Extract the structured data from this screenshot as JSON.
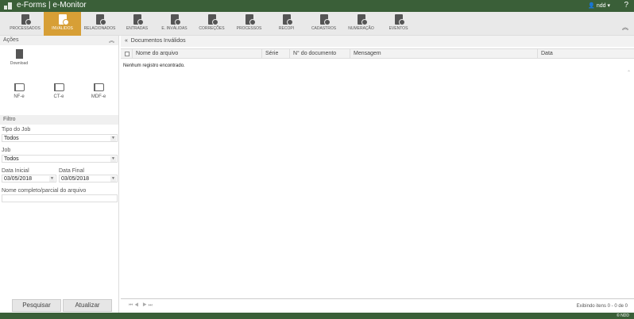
{
  "app": {
    "title": "e-Forms | e-Monitor",
    "user": "ndd",
    "help": "?",
    "copyright": "© NDD"
  },
  "toolbar": {
    "items": [
      {
        "label": "PROCESSADOS",
        "icon": "doc-check-icon"
      },
      {
        "label": "INVÁLIDOS",
        "icon": "doc-x-icon",
        "active": true
      },
      {
        "label": "RELACIONADOS",
        "icon": "doc-link-icon"
      },
      {
        "label": "ENTRADAS",
        "icon": "doc-in-icon"
      },
      {
        "label": "E. INVÁLIDAS",
        "icon": "doc-in-invalid-icon"
      },
      {
        "label": "CORREÇÕES",
        "icon": "doc-edit-icon"
      },
      {
        "label": "PROCESSOS",
        "icon": "doc-gear-icon"
      },
      {
        "label": "RECOPI",
        "icon": "doc-star-icon"
      },
      {
        "label": "CADASTROS",
        "icon": "clipboard-icon"
      },
      {
        "label": "NUMERAÇÃO",
        "icon": "doc-number-icon"
      },
      {
        "label": "EVENTOS",
        "icon": "doc-event-icon"
      }
    ],
    "active_color": "#d79f36"
  },
  "left": {
    "actions_title": "Ações",
    "download": "Download",
    "flags": [
      "NF-e",
      "CT-e",
      "MDF-e"
    ],
    "filter_title": "Filtro",
    "tipo_job_label": "Tipo do Job",
    "tipo_job_value": "Todos",
    "job_label": "Job",
    "job_value": "Todos",
    "data_inicial_label": "Data Inicial",
    "data_inicial": "03/05/2018",
    "data_final_label": "Data Final",
    "data_final": "03/05/2018",
    "nome_label": "Nome completo/parcial do arquivo",
    "nome_value": "",
    "search": "Pesquisar",
    "refresh": "Atualizar"
  },
  "main": {
    "title": "Documentos Inválidos",
    "columns": [
      "Nome do arquivo",
      "Série",
      "N° do documento",
      "Mensagem",
      "Data"
    ],
    "empty": "Nenhum registro encontrado.",
    "pager_info": "Exibindo itens 0 - 0 de 0"
  },
  "colors": {
    "header": "#3a5f38"
  }
}
